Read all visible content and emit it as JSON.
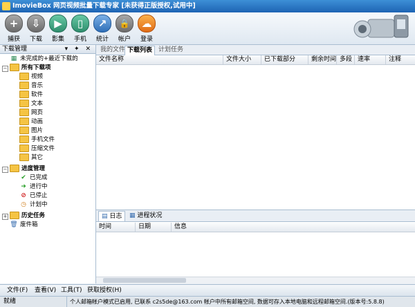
{
  "window": {
    "title": "ImovieBox 网页视频批量下载专家 [未获得正版授权,试用中]"
  },
  "toolbar": {
    "buttons": [
      {
        "label": "捕获",
        "icon": "plus-icon"
      },
      {
        "label": "下载",
        "icon": "download-icon"
      },
      {
        "label": "影集",
        "icon": "play-icon"
      },
      {
        "label": "手机",
        "icon": "mobile-phone-icon"
      },
      {
        "label": "统计",
        "icon": "chart-icon"
      },
      {
        "label": "帐户",
        "icon": "lock-icon"
      },
      {
        "label": "登录",
        "icon": "cloud-icon"
      }
    ]
  },
  "left_panel": {
    "title": "下载管理",
    "header_controls": "▾ ✦ ✕",
    "tree": {
      "recent": "未完成的+最近下载的",
      "all_downloads": "所有下载项",
      "categories": [
        "视频",
        "音乐",
        "软件",
        "文本",
        "网页",
        "动画",
        "图片",
        "手机文件",
        "压缩文件",
        "其它"
      ],
      "progress": "进度管理",
      "progress_items": [
        "已完成",
        "进行中",
        "已停止",
        "计划中"
      ],
      "history": "历史任务",
      "trash": "废件箱"
    }
  },
  "main": {
    "tabs": [
      "我的文件",
      "下载列表",
      "计划任务"
    ],
    "active_tab": "下载列表",
    "columns": [
      "文件名称",
      "文件大小",
      "已下载部分",
      "剩余时间",
      "多段",
      "速率",
      "注释"
    ]
  },
  "lower": {
    "tabs": [
      "日志",
      "进程状况"
    ],
    "columns": [
      "时间",
      "日期",
      "信息"
    ]
  },
  "menubar": {
    "items": [
      "文件(F)",
      "查看(V)",
      "工具(T)",
      "获取授权(H)"
    ]
  },
  "statusbar": {
    "state": "就绪",
    "message": "个人邮箱帐户模式已启用, 已联系 c2s5de@163.com 帐户中所有邮箱空间, 数据可存入本地电脑和远程邮箱空间.(版本号:5.8.8)"
  },
  "colors": {
    "title_blue": "#1e64b4",
    "panel_border": "#a9bdd1",
    "folder_yellow": "#f5c443"
  }
}
